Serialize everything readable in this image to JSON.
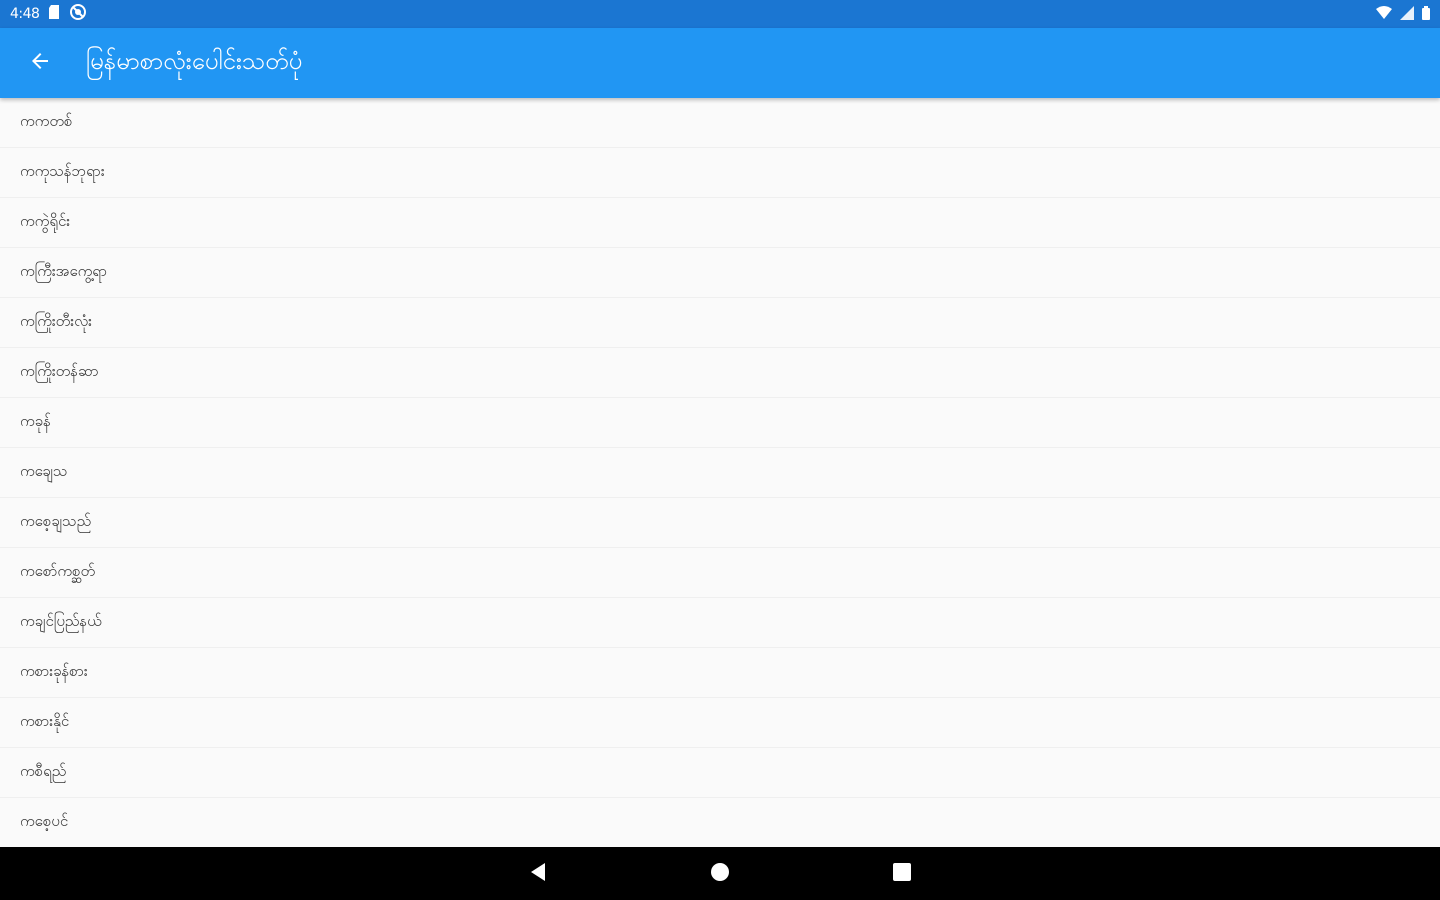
{
  "status_bar": {
    "time": "4:48",
    "icons_left": [
      "sd-card-icon",
      "sync-off-icon"
    ],
    "icons_right": [
      "wifi-icon",
      "cell-signal-icon",
      "battery-icon"
    ]
  },
  "app_bar": {
    "title": "မြန်မာစာလုံးပေါင်းသတ်ပုံ",
    "back_icon": "arrow-back-icon",
    "color": "#2196f3"
  },
  "list": {
    "items": [
      "ကကတစ်",
      "ကကုသန်ဘုရား",
      "ကကွဲရိုင်း",
      "ကကြီးအကွေ့ရာ",
      "ကကြိုးတီးလုံး",
      "ကကြိုးတန်ဆာ",
      "ကခုန်",
      "ကချေသ",
      "ကစေ့ချသည်",
      "ကစော်ကစ္ဆတ်",
      "ကချင်ပြည်နယ်",
      "ကစားခုန်စား",
      "ကစားနိုင်",
      "ကစီရည်",
      "ကစေ့ပင်"
    ]
  },
  "nav_bar": {
    "buttons": [
      "back-triangle-icon",
      "home-circle-icon",
      "recents-square-icon"
    ]
  }
}
